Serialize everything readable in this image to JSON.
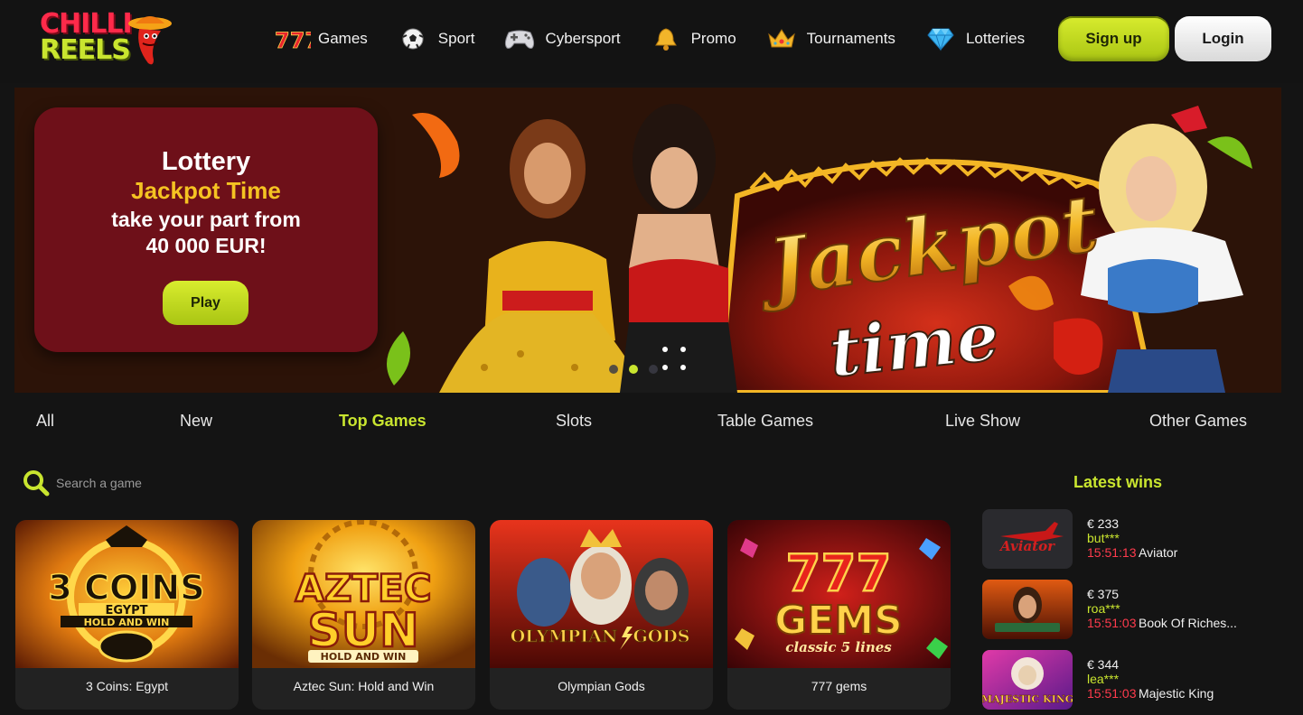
{
  "brand": {
    "logo_line1": "CHILLI",
    "logo_line2": "REELS"
  },
  "nav": {
    "items": [
      {
        "label": "Games",
        "icon": "sevens-icon"
      },
      {
        "label": "Sport",
        "icon": "soccer-ball-icon"
      },
      {
        "label": "Cybersport",
        "icon": "gamepad-icon"
      },
      {
        "label": "Promo",
        "icon": "bell-icon"
      },
      {
        "label": "Tournaments",
        "icon": "crown-icon"
      },
      {
        "label": "Lotteries",
        "icon": "diamond-icon"
      }
    ],
    "signup_label": "Sign up",
    "login_label": "Login"
  },
  "banner": {
    "line1": "Lottery",
    "line2": "Jackpot Time",
    "line3": "take your part from",
    "line4": "40 000 EUR!",
    "play_label": "Play",
    "art_title_1": "Jackpot",
    "art_title_2": "time",
    "slides_count": 3,
    "active_slide": 2
  },
  "categories": {
    "tabs": [
      "All",
      "New",
      "Top Games",
      "Slots",
      "Table Games",
      "Live Show",
      "Other Games"
    ],
    "active": "Top Games"
  },
  "search": {
    "placeholder": "Search a game"
  },
  "games": [
    {
      "name": "3 Coins: Egypt",
      "art_line1": "3 COINS",
      "art_line2": "EGYPT",
      "art_line3": "HOLD AND WIN"
    },
    {
      "name": "Aztec Sun: Hold and Win",
      "art_line1": "AZTEC",
      "art_line2": "SUN",
      "art_line3": "HOLD AND WIN"
    },
    {
      "name": "Olympian Gods",
      "art_line1": "OLYMPIAN",
      "art_line2": "GODS"
    },
    {
      "name": "777 gems",
      "art_line1": "777",
      "art_line2": "GEMS",
      "art_line3": "classic 5 lines"
    }
  ],
  "latest_wins": {
    "title": "Latest wins",
    "items": [
      {
        "amount": "€ 233",
        "user": "but***",
        "time": "15:51:13",
        "game": "Aviator",
        "thumb_text": "Aviator"
      },
      {
        "amount": "€ 375",
        "user": "roa***",
        "time": "15:51:03",
        "game": "Book Of Riches...",
        "thumb_text": ""
      },
      {
        "amount": "€ 344",
        "user": "lea***",
        "time": "15:51:03",
        "game": "Majestic King",
        "thumb_text": "MAJESTIC KING"
      }
    ]
  },
  "colors": {
    "accent": "#c9e52f",
    "background": "#141414",
    "promo_card": "#6e1019",
    "time_red": "#ff3b4d",
    "gold": "#f5c322"
  }
}
